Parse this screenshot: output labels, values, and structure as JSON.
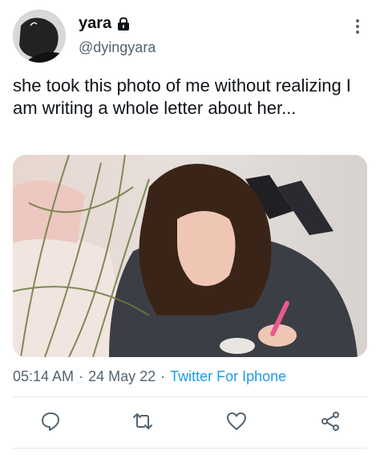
{
  "user": {
    "display_name": "yara",
    "handle": "@dyingyara"
  },
  "tweet": {
    "text": "she took this photo of me without realizing I am writing a whole letter about her..."
  },
  "meta": {
    "time": "05:14 AM",
    "date": "24 May 22",
    "separator": "·",
    "source": "Twitter For Iphone"
  },
  "icons": {
    "lock": "lock-icon",
    "more": "more-vertical-icon",
    "reply": "reply-icon",
    "retweet": "retweet-icon",
    "like": "like-icon",
    "share": "share-icon"
  },
  "colors": {
    "text": "#0f1419",
    "secondary": "#536471",
    "link": "#1d9bf0",
    "divider": "#e1e8ed"
  }
}
